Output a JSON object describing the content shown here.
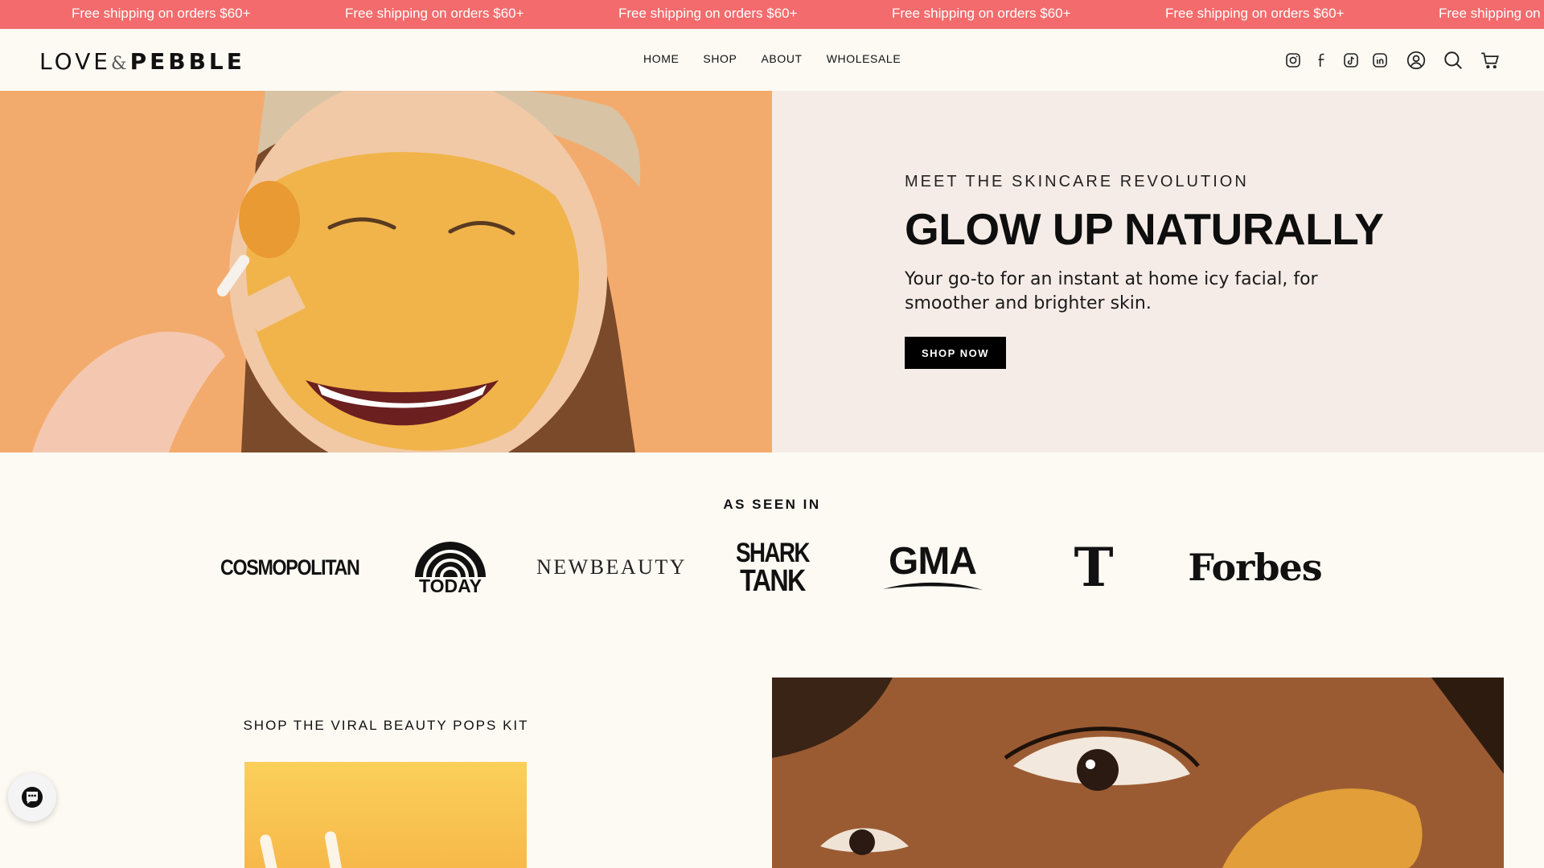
{
  "announcement": {
    "text": "Free shipping on orders $60+",
    "repeats": [
      "Free shipping on orders $60+",
      "Free shipping on orders $60+",
      "Free shipping on orders $60+",
      "Free shipping on orders $60+",
      "Free shipping on orders $60+",
      "Free shipping on"
    ],
    "background": "#f36b6c"
  },
  "header": {
    "logo": {
      "word1": "LOVE",
      "amp": "&",
      "word2": "PEBBLE"
    },
    "nav": [
      "HOME",
      "SHOP",
      "ABOUT",
      "WHOLESALE"
    ],
    "icons": [
      "instagram-icon",
      "facebook-icon",
      "tiktok-icon",
      "linkedin-icon",
      "account-icon",
      "search-icon",
      "cart-icon"
    ]
  },
  "hero": {
    "eyebrow": "MEET THE SKINCARE REVOLUTION",
    "title": "GLOW UP NATURALLY",
    "text": "Your go-to for an instant at home icy facial, for smoother and brighter skin.",
    "button": "SHOP NOW",
    "image_bg": "#f3ab6d",
    "panel_bg": "#f6ece7"
  },
  "press": {
    "title": "AS SEEN IN",
    "logos": [
      "COSMOPOLITAN",
      "TODAY",
      "NEWBEAUTY",
      "SHARK",
      "TANK",
      "GMA",
      "T",
      "Forbes"
    ]
  },
  "kit": {
    "title": "SHOP THE VIRAL BEAUTY POPS KIT"
  },
  "chat": {
    "icon": "chat-icon"
  }
}
